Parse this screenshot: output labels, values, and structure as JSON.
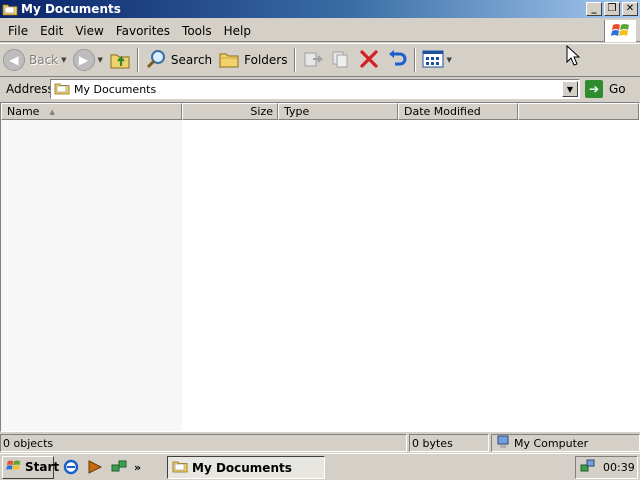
{
  "window": {
    "title": "My Documents",
    "buttons": {
      "minimize": "_",
      "restore": "❐",
      "close": "✕"
    }
  },
  "menu": {
    "items": [
      "File",
      "Edit",
      "View",
      "Favorites",
      "Tools",
      "Help"
    ]
  },
  "toolbar": {
    "back_label": "Back",
    "search_label": "Search",
    "folders_label": "Folders"
  },
  "address": {
    "label": "Address",
    "value": "My Documents",
    "go_label": "Go"
  },
  "columns": {
    "name": "Name",
    "size": "Size",
    "type": "Type",
    "date_modified": "Date Modified"
  },
  "status": {
    "objects": "0 objects",
    "bytes": "0 bytes",
    "location": "My Computer"
  },
  "taskbar": {
    "start_label": "Start",
    "chevron": "»",
    "task_label": "My Documents",
    "clock": "00:39"
  },
  "colors": {
    "title_active": "#0a246a",
    "face": "#d4d0c8",
    "delete_red": "#d42020",
    "undo_blue": "#1a5fd0"
  }
}
